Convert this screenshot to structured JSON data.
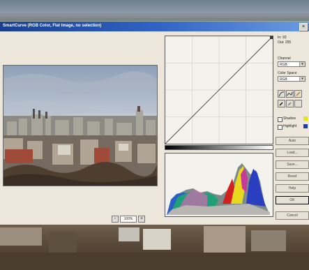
{
  "window": {
    "title": "SmartCurve (RGB Color, Flat Image, no selection)"
  },
  "readout": {
    "in": "In: 93",
    "out": "Out: 255"
  },
  "channel": {
    "label": "Channel",
    "value": "RGB"
  },
  "color_space": {
    "label": "Color Space",
    "value": "RGB"
  },
  "checkboxes": {
    "shadow": "Shadow",
    "highlight": "Highlight"
  },
  "buttons": {
    "auto": "Auto",
    "load": "Load...",
    "save": "Save...",
    "reset": "Reset",
    "help": "Help",
    "ok": "OK",
    "cancel": "Cancel"
  },
  "zoom": {
    "value": "100%",
    "minus": "-",
    "plus": "+"
  },
  "colors": {
    "title_start": "#1a3f8e",
    "title_end": "#6a9be0",
    "shadow_swatch": "#e8e21a",
    "highlight_swatch": "#1b3c9e"
  }
}
